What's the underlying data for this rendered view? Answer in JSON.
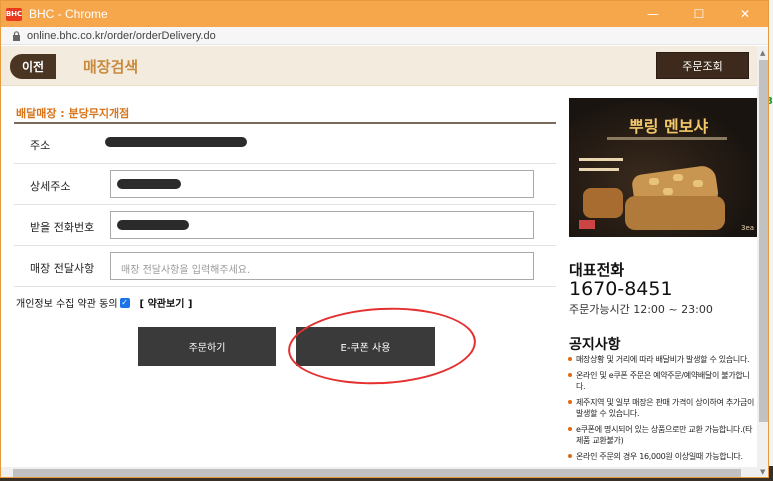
{
  "window": {
    "title": "BHC - Chrome",
    "favicon_text": "BHC",
    "url": "online.bhc.co.kr/order/orderDelivery.do"
  },
  "header": {
    "back_label": "이전",
    "title": "매장검색",
    "order_lookup_label": "주문조회"
  },
  "form": {
    "store_label": "배달매장 : 분당무지개점",
    "address_label": "주소",
    "address_detail_label": "상세주소",
    "phone_label": "받을 전화번호",
    "store_message_label": "매장 전달사항",
    "store_message_placeholder": "매장 전달사항을 입력해주세요.",
    "consent_label": "개인정보 수집 약관 동의",
    "consent_checked": true,
    "terms_link": "[ 약관보기 ]"
  },
  "buttons": {
    "order_label": "주문하기",
    "ecoupon_label": "E-쿠폰 사용"
  },
  "promo": {
    "title": "뿌링 멘보샤",
    "count_label": "3ea"
  },
  "contact": {
    "title": "대표전화",
    "phone": "1670-8451",
    "hours": "주문가능시간 12:00 ~ 23:00"
  },
  "notices": {
    "title": "공지사항",
    "items": [
      "매장상황 및 거리에 따라 배달비가 발생할 수 있습니다.",
      "온라인 및 e쿠폰 주문은 예약주문/예약배달이 불가합니다.",
      "제주지역 및 일부 매장은 판매 가격이 상이하여 추가금이 발생할 수 있습니다.",
      "e쿠폰에 명시되어 있는 상품으로만 교환 가능합니다.(타제품 교환불가)",
      "온라인 주문의 경우 16,000원 이상일때 가능합니다."
    ]
  },
  "colors": {
    "titlebar": "#f6a64b",
    "accent": "#c98a3e",
    "store_label": "#d9741b",
    "dark_button": "#3a3a3a",
    "annotation_circle": "#e53030"
  }
}
